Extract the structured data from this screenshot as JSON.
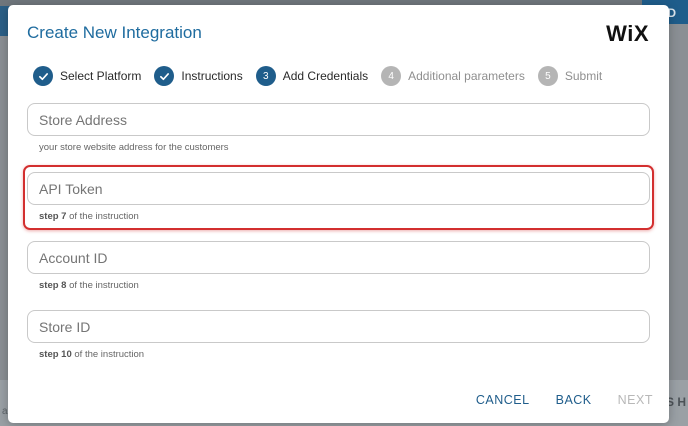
{
  "background": {
    "right_button_label": "ADD",
    "right_text": "S H",
    "bottom_text": "all the integration is seller and pinhttp loca"
  },
  "modal": {
    "title": "Create New Integration",
    "logo_text": "WiX"
  },
  "steps": [
    {
      "number": "1",
      "label": "Select Platform",
      "state": "done"
    },
    {
      "number": "2",
      "label": "Instructions",
      "state": "done"
    },
    {
      "number": "3",
      "label": "Add Credentials",
      "state": "active"
    },
    {
      "number": "4",
      "label": "Additional parameters",
      "state": "pending"
    },
    {
      "number": "5",
      "label": "Submit",
      "state": "pending"
    }
  ],
  "fields": {
    "store_address": {
      "placeholder": "Store Address",
      "value": "",
      "helper": "your store website address for the customers"
    },
    "api_token": {
      "placeholder": "API Token",
      "value": "",
      "helper_bold": "step 7",
      "helper_rest": " of the instruction"
    },
    "account_id": {
      "placeholder": "Account ID",
      "value": "",
      "helper_bold": "step 8",
      "helper_rest": " of the instruction"
    },
    "store_id": {
      "placeholder": "Store ID",
      "value": "",
      "helper_bold": "step 10",
      "helper_rest": " of the instruction"
    }
  },
  "footer": {
    "cancel_label": "CANCEL",
    "back_label": "BACK",
    "next_label": "NEXT"
  },
  "colors": {
    "accent": "#1f5d8b",
    "title": "#1f6c9f",
    "highlight": "#d32f2f",
    "pending": "#b5b5b5"
  }
}
